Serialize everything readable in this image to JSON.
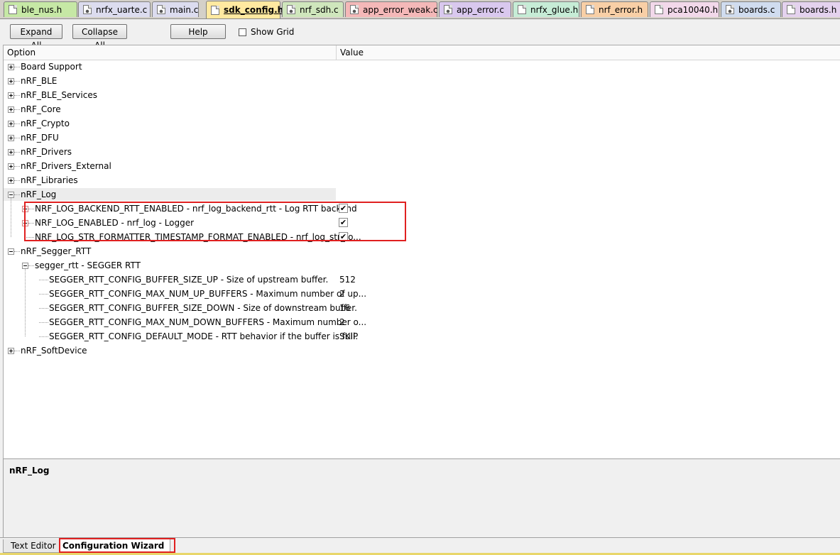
{
  "file_tabs": [
    {
      "label": "ble_nus.h",
      "color": "#c6e8a5",
      "icon": "header-file-icon"
    },
    {
      "label": "nrfx_uarte.c",
      "color": "#dcdcef",
      "icon": "c-source-file-icon"
    },
    {
      "label": "main.c",
      "color": "#dcdcef",
      "icon": "c-source-file-icon"
    },
    {
      "label": "sdk_config.h",
      "color": "#ffe9a0",
      "icon": "header-file-icon"
    },
    {
      "label": "nrf_sdh.c",
      "color": "#cfe6bc",
      "icon": "c-source-file-icon"
    },
    {
      "label": "app_error_weak.c",
      "color": "#f4b8b8",
      "icon": "c-source-file-icon"
    },
    {
      "label": "app_error.c",
      "color": "#d9c8ee",
      "icon": "c-source-file-icon"
    },
    {
      "label": "nrfx_glue.h",
      "color": "#c6ecd6",
      "icon": "header-file-icon"
    },
    {
      "label": "nrf_error.h",
      "color": "#f8cfa6",
      "icon": "header-file-icon"
    },
    {
      "label": "pca10040.h",
      "color": "#f2d8ea",
      "icon": "header-file-icon"
    },
    {
      "label": "boards.c",
      "color": "#d0dcef",
      "icon": "c-source-file-icon"
    },
    {
      "label": "boards.h",
      "color": "#e4d2ee",
      "icon": "header-file-icon"
    }
  ],
  "toolbar": {
    "expand_all": "Expand All",
    "collapse_all": "Collapse All",
    "help": "Help",
    "show_grid": "Show Grid"
  },
  "grid": {
    "col_option": "Option",
    "col_value": "Value",
    "rows": [
      {
        "level": 0,
        "expander": "plus",
        "label": "Board Support",
        "value": ""
      },
      {
        "level": 0,
        "expander": "plus",
        "label": "nRF_BLE",
        "value": ""
      },
      {
        "level": 0,
        "expander": "plus",
        "label": "nRF_BLE_Services",
        "value": ""
      },
      {
        "level": 0,
        "expander": "plus",
        "label": "nRF_Core",
        "value": ""
      },
      {
        "level": 0,
        "expander": "plus",
        "label": "nRF_Crypto",
        "value": ""
      },
      {
        "level": 0,
        "expander": "plus",
        "label": "nRF_DFU",
        "value": ""
      },
      {
        "level": 0,
        "expander": "plus",
        "label": "nRF_Drivers",
        "value": ""
      },
      {
        "level": 0,
        "expander": "plus",
        "label": "nRF_Drivers_External",
        "value": ""
      },
      {
        "level": 0,
        "expander": "plus",
        "label": "nRF_Libraries",
        "value": ""
      },
      {
        "level": 0,
        "expander": "minus",
        "label": "nRF_Log",
        "value": "",
        "selected": true
      },
      {
        "level": 1,
        "expander": "plus",
        "label": "NRF_LOG_BACKEND_RTT_ENABLED - nrf_log_backend_rtt - Log RTT backend",
        "checkbox": true
      },
      {
        "level": 1,
        "expander": "plus",
        "label": "NRF_LOG_ENABLED - nrf_log - Logger",
        "checkbox": true
      },
      {
        "level": 1,
        "expander": "none",
        "label": "NRF_LOG_STR_FORMATTER_TIMESTAMP_FORMAT_ENABLED  - nrf_log_str_fo...",
        "checkbox": true
      },
      {
        "level": 0,
        "expander": "minus",
        "label": "nRF_Segger_RTT",
        "value": ""
      },
      {
        "level": 1,
        "expander": "minus",
        "label": "segger_rtt - SEGGER RTT",
        "value": ""
      },
      {
        "level": 2,
        "expander": "none",
        "label": "SEGGER_RTT_CONFIG_BUFFER_SIZE_UP - Size of upstream buffer.",
        "value": "512"
      },
      {
        "level": 2,
        "expander": "none",
        "label": "SEGGER_RTT_CONFIG_MAX_NUM_UP_BUFFERS - Maximum number of up...",
        "value": "2"
      },
      {
        "level": 2,
        "expander": "none",
        "label": "SEGGER_RTT_CONFIG_BUFFER_SIZE_DOWN - Size of downstream buffer.",
        "value": "16"
      },
      {
        "level": 2,
        "expander": "none",
        "label": "SEGGER_RTT_CONFIG_MAX_NUM_DOWN_BUFFERS - Maximum number o...",
        "value": "2"
      },
      {
        "level": 2,
        "expander": "none",
        "label": "SEGGER_RTT_CONFIG_DEFAULT_MODE  - RTT behavior if the buffer is full.",
        "value": "SKIP"
      },
      {
        "level": 0,
        "expander": "plus",
        "label": "nRF_SoftDevice",
        "value": ""
      }
    ]
  },
  "description": {
    "title": "nRF_Log"
  },
  "bottom_tabs": {
    "text_editor": "Text Editor",
    "config_wizard": "Configuration Wizard"
  },
  "colors": {
    "highlight_box": "#e02020",
    "bottom_strip": "#e8d66a"
  }
}
